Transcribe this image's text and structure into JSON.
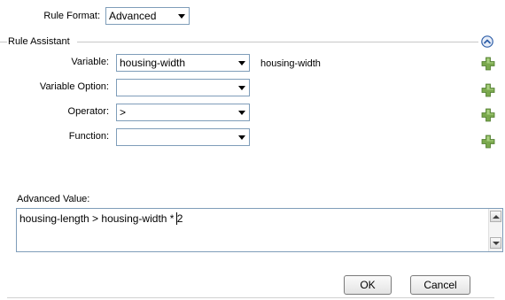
{
  "rule_format": {
    "label": "Rule Format:",
    "value": "Advanced"
  },
  "rule_assistant": {
    "title": "Rule Assistant",
    "collapse_icon": "chevron-up-circle-icon",
    "add_icon": "green-plus-icon",
    "fields": [
      {
        "label": "Variable:",
        "value": "housing-width",
        "display": "housing-width"
      },
      {
        "label": "Variable Option:",
        "value": ""
      },
      {
        "label": "Operator:",
        "value": ">"
      },
      {
        "label": "Function:",
        "value": ""
      }
    ]
  },
  "advanced_value": {
    "label": "Advanced Value:",
    "text": "housing-length > housing-width * 2"
  },
  "buttons": {
    "ok": "OK",
    "cancel": "Cancel"
  },
  "colors": {
    "border": "#7f9db9",
    "plus_green": "#6f9e45",
    "collapse_blue": "#2f5fa8"
  }
}
